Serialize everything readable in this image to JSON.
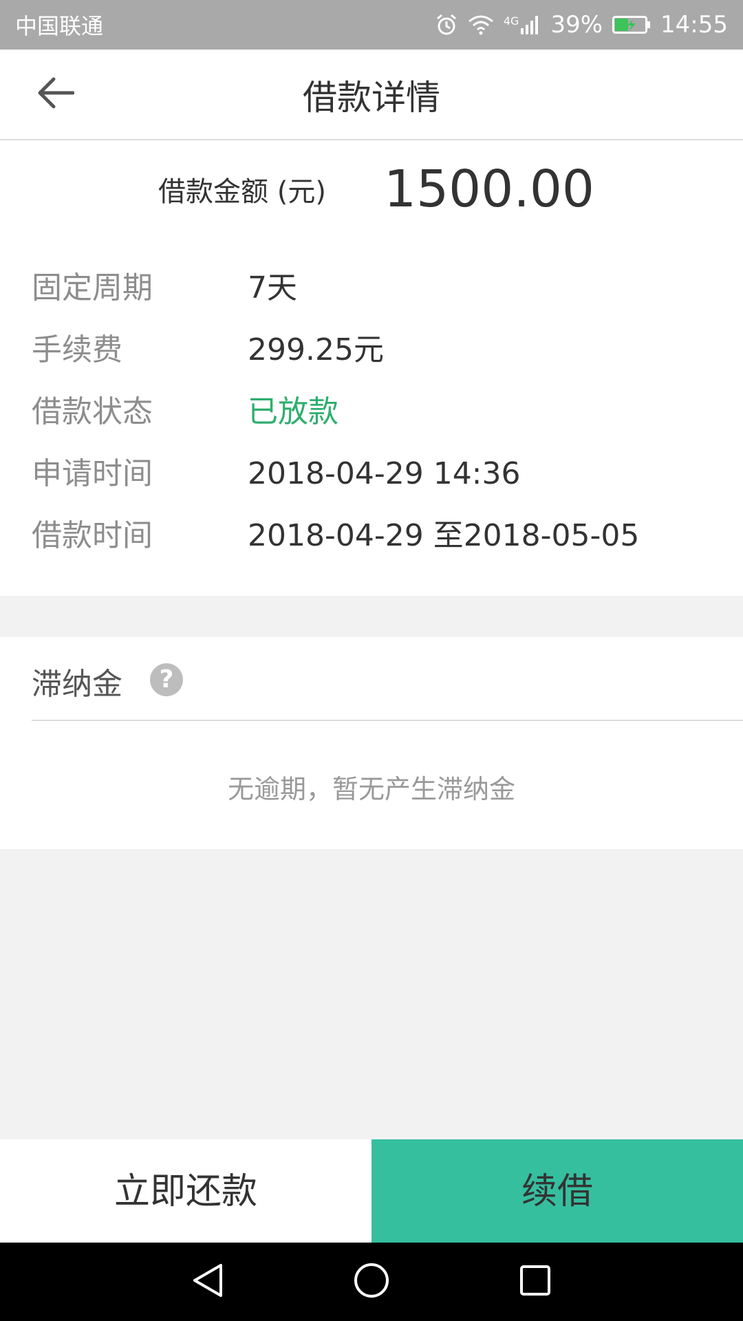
{
  "status_bar": {
    "carrier": "中国联通",
    "network": "4G",
    "battery": "39%",
    "time": "14:55",
    "icons": [
      "alarm-icon",
      "wifi-icon",
      "signal-icon",
      "battery-charging-icon"
    ]
  },
  "header": {
    "back_icon": "arrow-left-icon",
    "title": "借款详情"
  },
  "loan": {
    "amount_label": "借款金额 (元)",
    "amount_value": "1500.00",
    "rows": [
      {
        "label": "固定周期",
        "value": "7天"
      },
      {
        "label": "手续费",
        "value": "299.25元"
      },
      {
        "label": "借款状态",
        "value": "已放款"
      },
      {
        "label": "申请时间",
        "value": "2018-04-29 14:36"
      },
      {
        "label": "借款时间",
        "value": "2018-04-29 至2018-05-05"
      }
    ],
    "status_color": "#2fae6e"
  },
  "late_fee": {
    "title": "滞纳金",
    "help_icon": "question-circle-icon",
    "help_glyph": "?",
    "message": "无逾期，暂无产生滞纳金"
  },
  "actions": {
    "repay_label": "立即还款",
    "renew_label": "续借",
    "accent_color": "#35bf9f"
  },
  "nav_bar": {
    "icons": [
      "back-triangle-icon",
      "home-circle-icon",
      "recents-square-icon"
    ]
  }
}
